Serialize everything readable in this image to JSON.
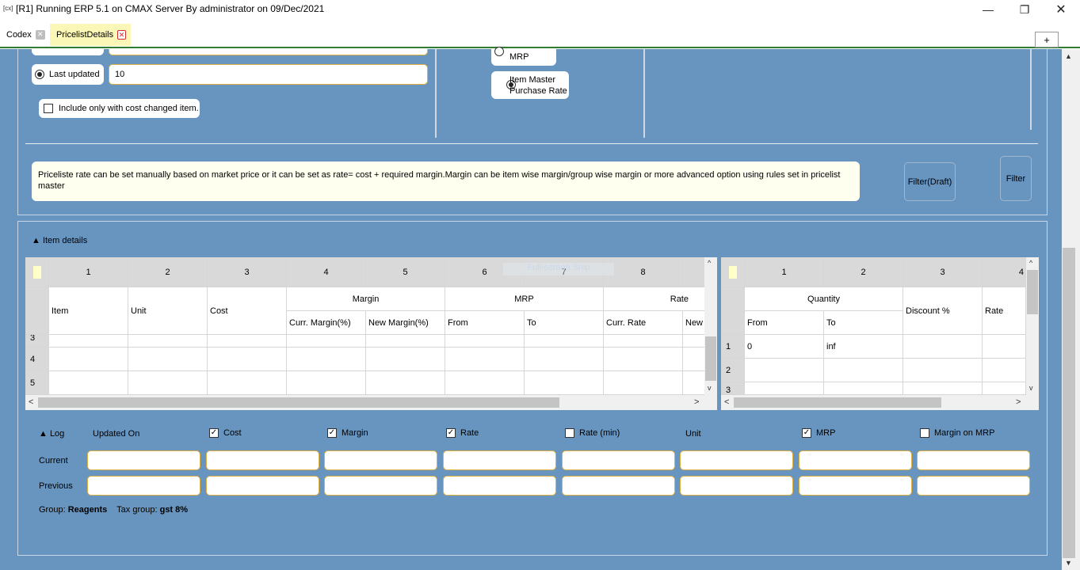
{
  "window": {
    "app_icon": "[cx]",
    "title": "[R1] Running ERP 5.1 on CMAX Server By administrator on 09/Dec/2021",
    "minimize_glyph": "—",
    "maximize_glyph": "❐",
    "close_glyph": "✕"
  },
  "tabs": [
    {
      "label": "Codex",
      "close_glyph": "✕"
    },
    {
      "label": "PricelistDetails",
      "close_glyph": "✕"
    }
  ],
  "new_tab_label": "+",
  "filters": {
    "last_updated_label": "Last updated",
    "last_updated_value": "10",
    "cost_changed_label": "Include only with cost changed item.",
    "rate_source": {
      "mrp_label": "MRP",
      "purchase_label_line1": "Item Master",
      "purchase_label_line2": "Purchase Rate",
      "selected": "Item Master Purchase Rate"
    },
    "info_text": "Priceliste rate can be set manually based on market price or it can be set as rate= cost + required margin.Margin can be item wise margin/group wise margin or more advanced option using rules set in pricelist master",
    "filter_draft_label": "Filter(Draft)",
    "filter_label": "Filter"
  },
  "item_details": {
    "label": "▲ Item details",
    "overlay_text": "Full-screen Snip",
    "column_numbers": [
      "1",
      "2",
      "3",
      "4",
      "5",
      "6",
      "7",
      "8"
    ],
    "group_headers": {
      "margin": "Margin",
      "mrp": "MRP",
      "rate": "Rate"
    },
    "sub_headers": {
      "item": "Item",
      "unit": "Unit",
      "cost": "Cost",
      "curr_margin": "Curr. Margin(%)",
      "new_margin": "New Margin(%)",
      "from": "From",
      "to": "To",
      "curr_rate": "Curr. Rate",
      "new_rate": "New"
    },
    "row_numbers": [
      "3",
      "4",
      "5"
    ]
  },
  "qty_grid": {
    "column_numbers": [
      "1",
      "2",
      "3",
      "4"
    ],
    "group_header": "Quantity",
    "sub_headers": {
      "from": "From",
      "to": "To",
      "discount": "Discount %",
      "rate": "Rate"
    },
    "rows": [
      {
        "num": "1",
        "from": "0",
        "to": "inf"
      },
      {
        "num": "2",
        "from": "",
        "to": ""
      },
      {
        "num": "3",
        "from": "",
        "to": ""
      }
    ]
  },
  "log": {
    "toggle_label": "▲ Log",
    "updated_on_label": "Updated On",
    "columns": [
      {
        "label": "Cost",
        "checked": true
      },
      {
        "label": "Margin",
        "checked": true
      },
      {
        "label": "Rate",
        "checked": true
      },
      {
        "label": "Rate (min)",
        "checked": false
      },
      {
        "label": "Unit",
        "checked": null
      },
      {
        "label": "MRP",
        "checked": true
      },
      {
        "label": "Margin on MRP",
        "checked": false
      }
    ],
    "check_glyph": "✓",
    "current_label": "Current",
    "previous_label": "Previous",
    "group_label": "Group:",
    "group_value": "Reagents",
    "tax_group_label": "Tax group:",
    "tax_group_value": "gst 8%"
  },
  "scroll_glyphs": {
    "up": "▲",
    "down": "▼",
    "left": "<",
    "right": ">",
    "up_caret": "^",
    "down_caret": "v"
  },
  "colors": {
    "panel": "#6795c0",
    "accent_line": "#2e7d32",
    "tab_active": "#fbf7b6",
    "info_bg": "#fffff0",
    "field_border": "#e0b040"
  }
}
